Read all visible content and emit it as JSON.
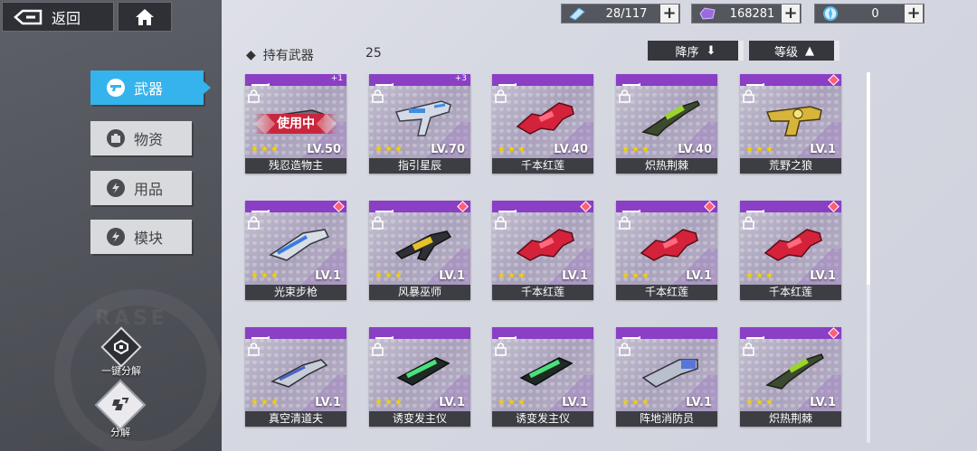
{
  "header": {
    "back_label": "返回",
    "home_icon": "home-icon",
    "resources": [
      {
        "icon": "ticket-icon",
        "value": "28/117"
      },
      {
        "icon": "crystal-icon",
        "value": "168281"
      },
      {
        "icon": "energy-orb-icon",
        "value": "0"
      }
    ]
  },
  "sidebar": {
    "items": [
      {
        "label": "武器",
        "icon": "weapon-icon",
        "active": true
      },
      {
        "label": "物资",
        "icon": "supply-icon",
        "active": false
      },
      {
        "label": "用品",
        "icon": "bolt-icon",
        "active": false
      },
      {
        "label": "模块",
        "icon": "bolt-icon",
        "active": false
      }
    ],
    "watermark": "RASE",
    "actions": {
      "quick_dismantle": "一键分解",
      "dismantle": "分解"
    }
  },
  "list": {
    "title": "持有武器",
    "count": "25",
    "sort_order_label": "降序",
    "sort_key_label": "等级"
  },
  "colors": {
    "accent": "#35b3ec",
    "card_top": "#8a3fc4",
    "gem": "#ff5f79",
    "star": "#f4d000",
    "in_use": "#c9263d"
  },
  "weapons": [
    {
      "name": "残忍造物主",
      "level": "LV.50",
      "stars": "★★★",
      "in_use": "使用中",
      "corner": "num",
      "corner_text": "+1",
      "type": "pistol-gray"
    },
    {
      "name": "指引星辰",
      "level": "LV.70",
      "stars": "★★★",
      "in_use": "",
      "corner": "num",
      "corner_text": "+3",
      "type": "smg-blue"
    },
    {
      "name": "千本红莲",
      "level": "LV.40",
      "stars": "★★★",
      "in_use": "",
      "corner": "none",
      "corner_text": "",
      "type": "rifle-red"
    },
    {
      "name": "炽热荆棘",
      "level": "LV.40",
      "stars": "★★★",
      "in_use": "",
      "corner": "none",
      "corner_text": "",
      "type": "sniper-green"
    },
    {
      "name": "荒野之狼",
      "level": "LV.1",
      "stars": "★★★",
      "in_use": "",
      "corner": "gem",
      "corner_text": "",
      "type": "pistol-gold"
    },
    {
      "name": "光束步枪",
      "level": "LV.1",
      "stars": "★★★",
      "in_use": "",
      "corner": "gem",
      "corner_text": "",
      "type": "beam-silver"
    },
    {
      "name": "风暴巫师",
      "level": "LV.1",
      "stars": "★★★",
      "in_use": "",
      "corner": "gem",
      "corner_text": "",
      "type": "smg-gold"
    },
    {
      "name": "千本红莲",
      "level": "LV.1",
      "stars": "★★★",
      "in_use": "",
      "corner": "gem",
      "corner_text": "",
      "type": "rifle-red"
    },
    {
      "name": "千本红莲",
      "level": "LV.1",
      "stars": "★★★",
      "in_use": "",
      "corner": "gem",
      "corner_text": "",
      "type": "rifle-red"
    },
    {
      "name": "千本红莲",
      "level": "LV.1",
      "stars": "★★★",
      "in_use": "",
      "corner": "gem",
      "corner_text": "",
      "type": "rifle-red"
    },
    {
      "name": "真空清道夫",
      "level": "LV.1",
      "stars": "★★★",
      "in_use": "",
      "corner": "none",
      "corner_text": "",
      "type": "vacuum-silver"
    },
    {
      "name": "诱变发主仪",
      "level": "LV.1",
      "stars": "★★★",
      "in_use": "",
      "corner": "none",
      "corner_text": "",
      "type": "launcher-green"
    },
    {
      "name": "诱变发主仪",
      "level": "LV.1",
      "stars": "★★★",
      "in_use": "",
      "corner": "none",
      "corner_text": "",
      "type": "launcher-green"
    },
    {
      "name": "阵地消防员",
      "level": "LV.1",
      "stars": "★★★",
      "in_use": "",
      "corner": "none",
      "corner_text": "",
      "type": "cannon-silver"
    },
    {
      "name": "炽热荆棘",
      "level": "LV.1",
      "stars": "★★★",
      "in_use": "",
      "corner": "gem",
      "corner_text": "",
      "type": "sniper-green"
    }
  ]
}
